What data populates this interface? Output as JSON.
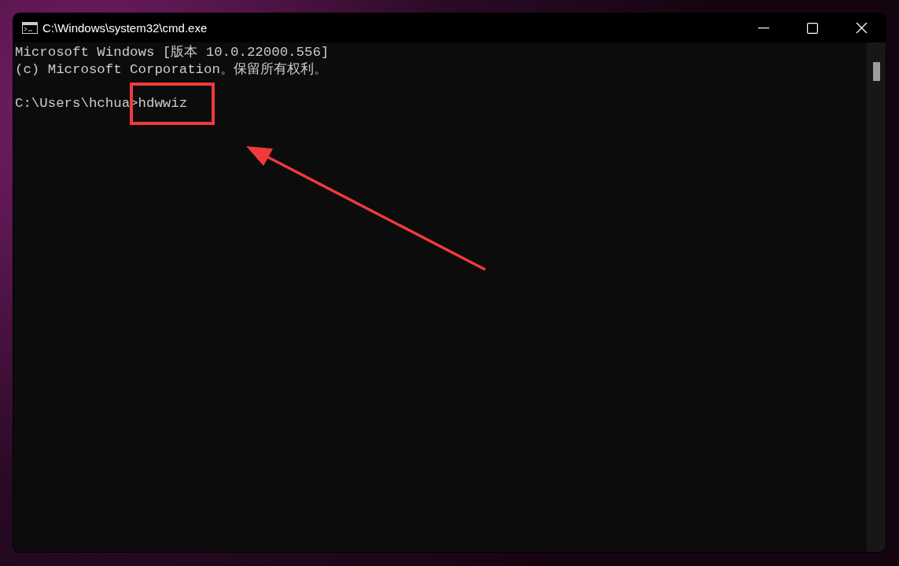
{
  "window": {
    "title": "C:\\Windows\\system32\\cmd.exe"
  },
  "console": {
    "banner": [
      "Microsoft Windows [版本 10.0.22000.556]",
      "(c) Microsoft Corporation。保留所有权利。"
    ],
    "prompt_line": "C:\\Users\\hchua>hdwwiz"
  }
}
